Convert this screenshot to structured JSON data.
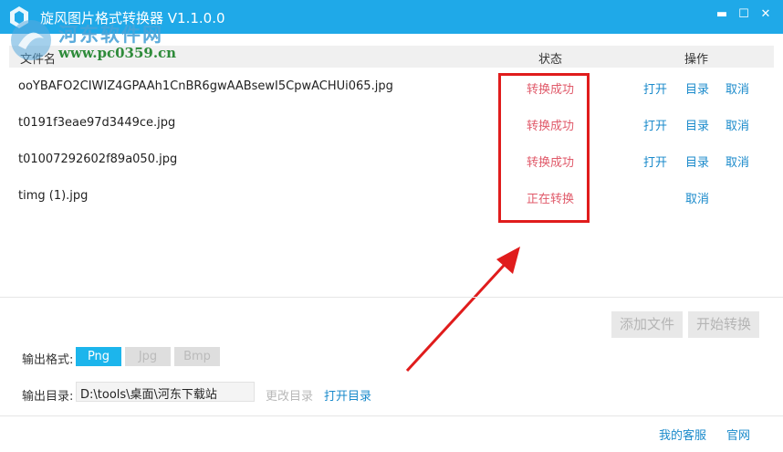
{
  "window": {
    "title": "旋风图片格式转换器 V1.1.0.0",
    "controls": {
      "minimize": "▬",
      "maximize": "☐",
      "close": "✕"
    }
  },
  "watermark": {
    "line1": "河东软件网",
    "line2": "www.pc0359.cn"
  },
  "list": {
    "columns": {
      "name": "文件名",
      "status": "状态",
      "operations": "操作"
    },
    "rows": [
      {
        "name": "ooYBAFO2CIWIZ4GPAAh1CnBR6gwAABsewI5CpwACHUi065.jpg",
        "status": "转换成功",
        "open": "打开",
        "dir": "目录",
        "cancel": "取消"
      },
      {
        "name": "t0191f3eae97d3449ce.jpg",
        "status": "转换成功",
        "open": "打开",
        "dir": "目录",
        "cancel": "取消"
      },
      {
        "name": "t01007292602f89a050.jpg",
        "status": "转换成功",
        "open": "打开",
        "dir": "目录",
        "cancel": "取消"
      },
      {
        "name": "timg (1).jpg",
        "status": "正在转换",
        "cancel": "取消"
      }
    ]
  },
  "actions": {
    "add_files": "添加文件",
    "start_convert": "开始转换"
  },
  "settings": {
    "format_label": "输出格式:",
    "formats": [
      "Png",
      "Jpg",
      "Bmp"
    ],
    "selected_format": "Png",
    "dir_label": "输出目录:",
    "dir_value": "D:\\tools\\桌面\\河东下载站",
    "change_dir": "更改目录",
    "open_dir": "打开目录"
  },
  "footer": {
    "service": "我的客服",
    "website": "官网"
  },
  "colors": {
    "titlebar": "#1fa9e8",
    "link": "#1a8acb",
    "status": "#e05a6a",
    "highlight": "#e01c1c",
    "selected_format": "#1cb5ec"
  }
}
